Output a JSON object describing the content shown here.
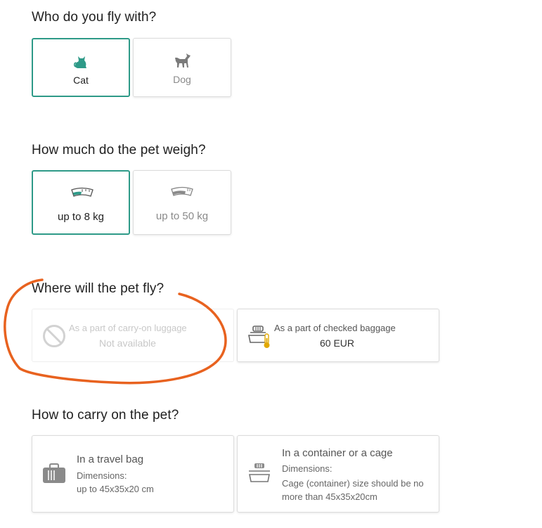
{
  "sections": {
    "species": {
      "title": "Who do you fly with?",
      "options": [
        {
          "label": "Cat",
          "selected": true,
          "icon": "cat-icon"
        },
        {
          "label": "Dog",
          "selected": false,
          "icon": "dog-icon"
        }
      ]
    },
    "weight": {
      "title": "How much do the pet weigh?",
      "options": [
        {
          "label": "up to 8 kg",
          "selected": true,
          "icon": "scale-icon"
        },
        {
          "label": "up to 50 kg",
          "selected": false,
          "icon": "scale-icon"
        }
      ]
    },
    "placement": {
      "title": "Where will the pet fly?",
      "options": [
        {
          "label": "As a part of carry-on luggage",
          "value": "Not available",
          "available": false,
          "icon": "no-entry-icon"
        },
        {
          "label": "As a part of checked baggage",
          "value": "60 EUR",
          "available": true,
          "icon": "carrier-thermometer-icon"
        }
      ]
    },
    "carry": {
      "title": "How to carry on the pet?",
      "options": [
        {
          "title": "In a travel bag",
          "dimensions_label": "Dimensions:",
          "dimensions_value": "up to 45x35x20 cm",
          "icon": "travel-bag-icon"
        },
        {
          "title": "In a container or a cage",
          "dimensions_label": "Dimensions:",
          "dimensions_value": "Cage (container) size should be no more than 45x35x20cm",
          "icon": "cage-icon"
        }
      ]
    }
  },
  "colors": {
    "accent": "#2e9a88",
    "muted_text": "#8a8a8a",
    "annotation": "#e8621f"
  }
}
